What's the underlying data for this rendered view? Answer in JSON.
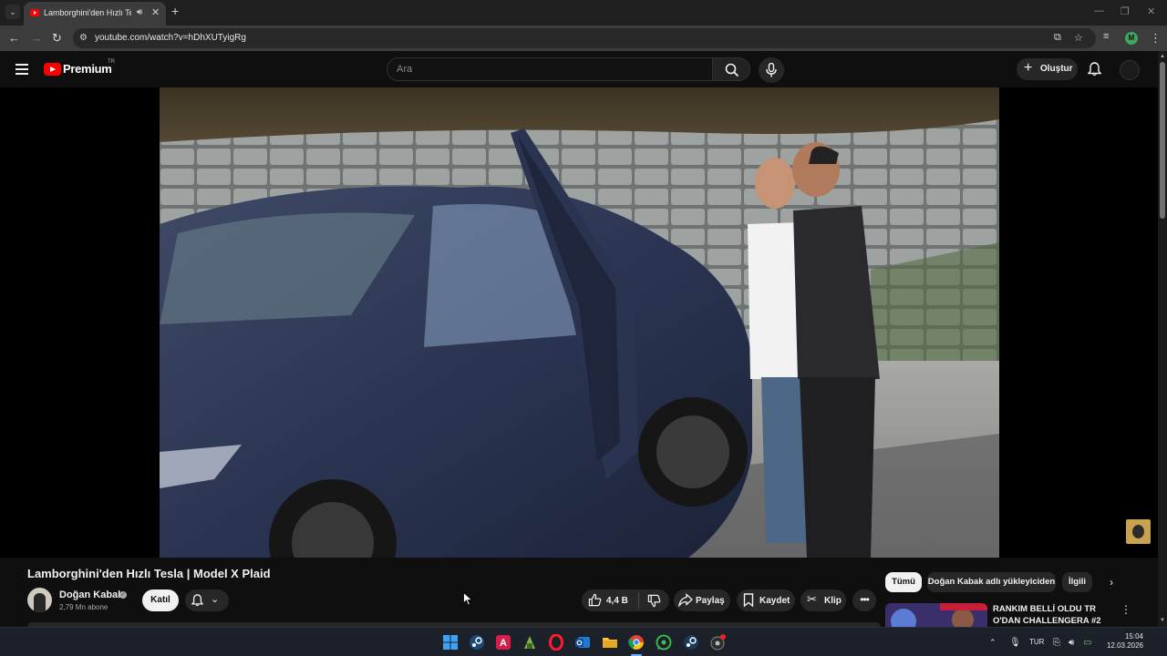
{
  "browser": {
    "tab_title": "Lamborghini'den Hızlı Tesla",
    "url": "youtube.com/watch?v=hDhXUTyigRg",
    "profile_initial": "M"
  },
  "header": {
    "logo_text": "Premium",
    "country_code": "TR",
    "search_placeholder": "Ara",
    "create_label": "Oluştur"
  },
  "video": {
    "title": "Lamborghini'den Hızlı Tesla | Model X Plaid",
    "channel_name": "Doğan Kabak",
    "subscribers": "2,79 Mn abone",
    "join_label": "Katıl",
    "like_count": "4,4 B",
    "share_label": "Paylaş",
    "save_label": "Kaydet",
    "clip_label": "Klip",
    "more_label": "•••"
  },
  "sidebar": {
    "chips": [
      {
        "label": "Tümü",
        "active": true
      },
      {
        "label": "Doğan Kabak adlı yükleyiciden",
        "active": false
      },
      {
        "label": "İlgili",
        "active": false
      }
    ],
    "recommendation": {
      "title": "RANKIM BELLİ OLDU TR O'DAN CHALLENGERA #2"
    }
  },
  "taskbar": {
    "language": "TUR",
    "time": "15:04",
    "date": "12.03.2026"
  },
  "colors": {
    "youtube_red": "#ff0000",
    "background": "#0f0f0f",
    "chip_bg": "#272727"
  }
}
